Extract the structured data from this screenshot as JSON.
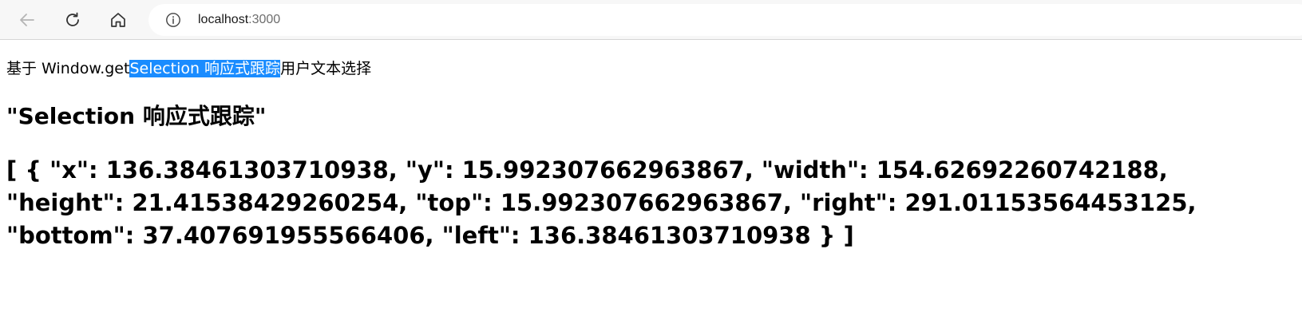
{
  "browser": {
    "url_host": "localhost",
    "url_port": ":3000"
  },
  "page": {
    "intro_before": "基于 Window.get",
    "intro_selected": "Selection 响应式跟踪",
    "intro_after": "用户文本选择",
    "selection_heading": "\"Selection 响应式跟踪\"",
    "selection_rects": "[ { \"x\": 136.38461303710938, \"y\": 15.992307662963867, \"width\": 154.62692260742188, \"height\": 21.41538429260254, \"top\": 15.992307662963867, \"right\": 291.01153564453125, \"bottom\": 37.407691955566406, \"left\": 136.38461303710938 } ]"
  },
  "icons": {
    "back": "arrow-left-icon",
    "reload": "reload-icon",
    "home": "home-icon",
    "info": "info-icon"
  },
  "colors": {
    "selection_bg": "#1a8cff",
    "selection_text": "#ffffff"
  }
}
